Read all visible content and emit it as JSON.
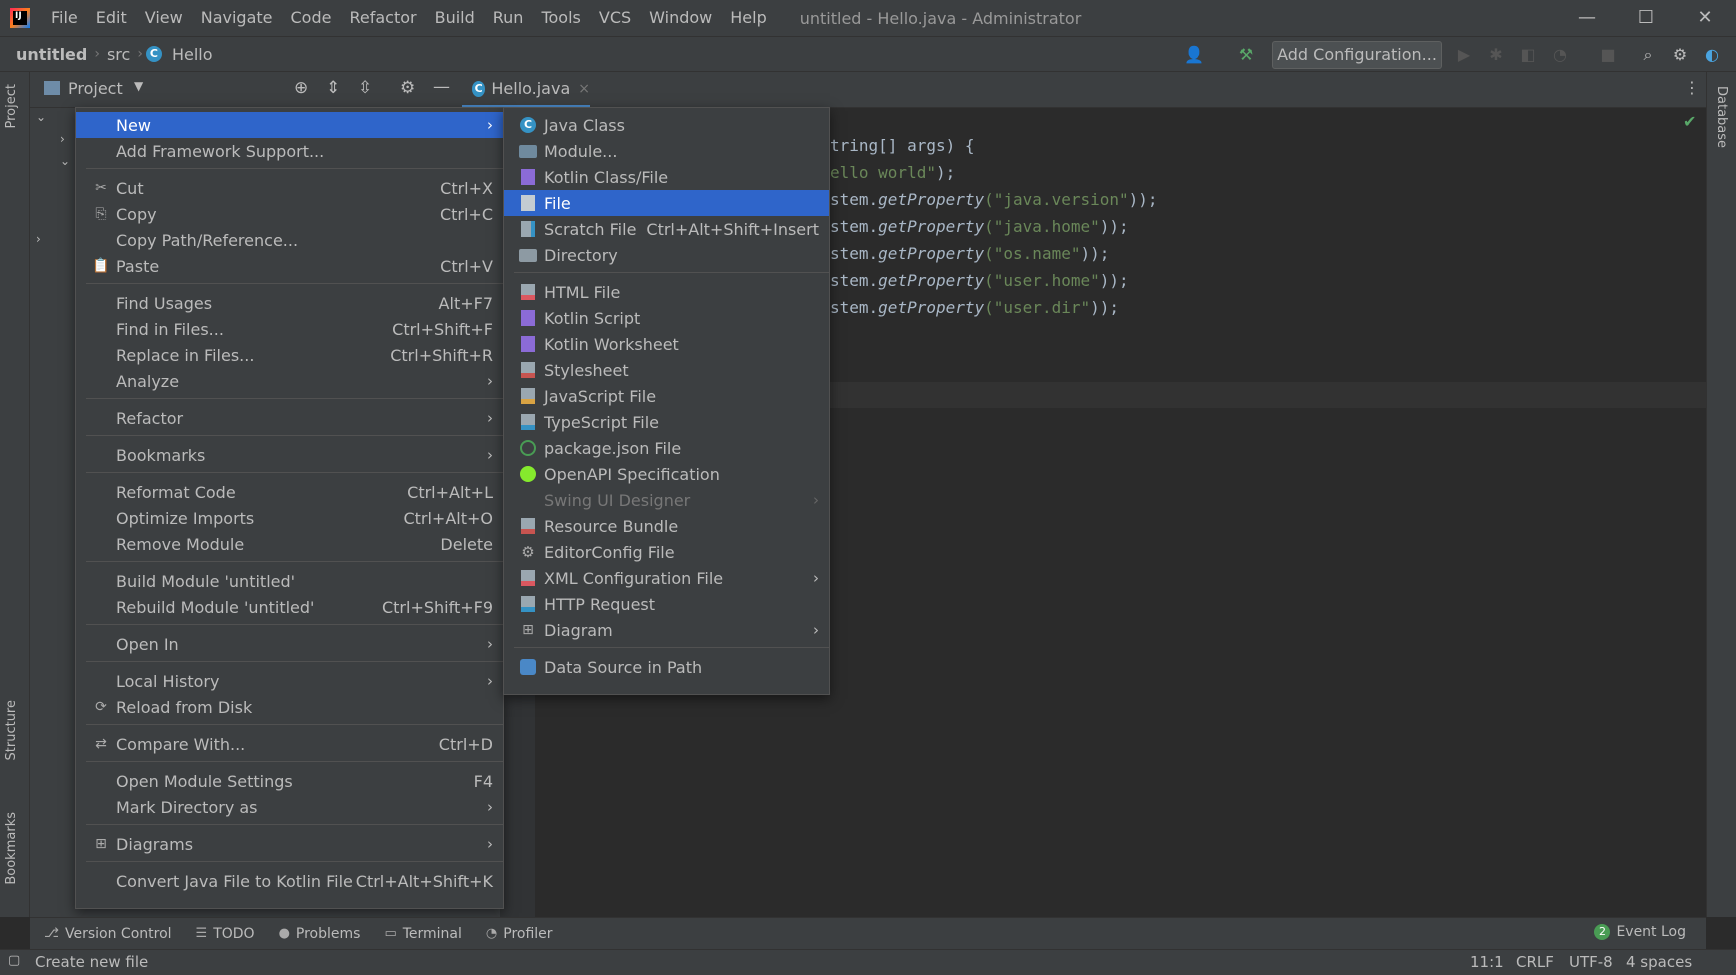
{
  "app": {
    "window_title": "untitled - Hello.java - Administrator",
    "menu": [
      "File",
      "Edit",
      "View",
      "Navigate",
      "Code",
      "Refactor",
      "Build",
      "Run",
      "Tools",
      "VCS",
      "Window",
      "Help"
    ],
    "win_controls": [
      "—",
      "☐",
      "✕"
    ]
  },
  "navbar": {
    "crumbs": [
      "untitled",
      "src",
      "Hello"
    ],
    "add_config_label": "Add Configuration..."
  },
  "project": {
    "header_label": "Project",
    "stripe_label": "Project",
    "structure_label": "Structure",
    "bookmarks_label": "Bookmarks",
    "database_label": "Database"
  },
  "editor": {
    "tab_label": "Hello.java",
    "tab_close": "×",
    "lines": [
      {
        "pre": "tring[] args) {",
        "fn": "",
        "str": "",
        "post": ""
      },
      {
        "pre": "",
        "fn": "",
        "str": "ello world\"",
        "post": ");"
      },
      {
        "pre": "stem.",
        "fn": "getProperty",
        "str": "(\"java.version\"",
        "post": "));"
      },
      {
        "pre": "stem.",
        "fn": "getProperty",
        "str": "(\"java.home\"",
        "post": "));"
      },
      {
        "pre": "stem.",
        "fn": "getProperty",
        "str": "(\"os.name\"",
        "post": "));"
      },
      {
        "pre": "stem.",
        "fn": "getProperty",
        "str": "(\"user.home\"",
        "post": "));"
      },
      {
        "pre": "stem.",
        "fn": "getProperty",
        "str": "(\"user.dir\"",
        "post": "));"
      }
    ]
  },
  "context_menu": [
    {
      "label": "New",
      "shortcut": "",
      "submenu": true,
      "icon": "",
      "selected": true
    },
    {
      "label": "Add Framework Support...",
      "shortcut": "",
      "submenu": false,
      "icon": ""
    },
    {
      "sep": true
    },
    {
      "label": "Cut",
      "shortcut": "Ctrl+X",
      "icon": "✂"
    },
    {
      "label": "Copy",
      "shortcut": "Ctrl+C",
      "icon": "⎘"
    },
    {
      "label": "Copy Path/Reference...",
      "shortcut": "",
      "icon": ""
    },
    {
      "label": "Paste",
      "shortcut": "Ctrl+V",
      "icon": "📋"
    },
    {
      "sep": true
    },
    {
      "label": "Find Usages",
      "shortcut": "Alt+F7",
      "icon": ""
    },
    {
      "label": "Find in Files...",
      "shortcut": "Ctrl+Shift+F",
      "icon": ""
    },
    {
      "label": "Replace in Files...",
      "shortcut": "Ctrl+Shift+R",
      "icon": ""
    },
    {
      "label": "Analyze",
      "shortcut": "",
      "submenu": true,
      "icon": ""
    },
    {
      "sep": true
    },
    {
      "label": "Refactor",
      "shortcut": "",
      "submenu": true,
      "icon": ""
    },
    {
      "sep": true
    },
    {
      "label": "Bookmarks",
      "shortcut": "",
      "submenu": true,
      "icon": ""
    },
    {
      "sep": true
    },
    {
      "label": "Reformat Code",
      "shortcut": "Ctrl+Alt+L",
      "icon": ""
    },
    {
      "label": "Optimize Imports",
      "shortcut": "Ctrl+Alt+O",
      "icon": ""
    },
    {
      "label": "Remove Module",
      "shortcut": "Delete",
      "icon": ""
    },
    {
      "sep": true
    },
    {
      "label": "Build Module 'untitled'",
      "shortcut": "",
      "icon": ""
    },
    {
      "label": "Rebuild Module 'untitled'",
      "shortcut": "Ctrl+Shift+F9",
      "icon": ""
    },
    {
      "sep": true
    },
    {
      "label": "Open In",
      "shortcut": "",
      "submenu": true,
      "icon": ""
    },
    {
      "sep": true
    },
    {
      "label": "Local History",
      "shortcut": "",
      "submenu": true,
      "icon": ""
    },
    {
      "label": "Reload from Disk",
      "shortcut": "",
      "icon": "⟳"
    },
    {
      "sep": true
    },
    {
      "label": "Compare With...",
      "shortcut": "Ctrl+D",
      "icon": "⇄"
    },
    {
      "sep": true
    },
    {
      "label": "Open Module Settings",
      "shortcut": "F4",
      "icon": ""
    },
    {
      "label": "Mark Directory as",
      "shortcut": "",
      "submenu": true,
      "icon": ""
    },
    {
      "sep": true
    },
    {
      "label": "Diagrams",
      "shortcut": "",
      "submenu": true,
      "icon": "⊞"
    },
    {
      "sep": true
    },
    {
      "label": "Convert Java File to Kotlin File",
      "shortcut": "Ctrl+Alt+Shift+K",
      "icon": ""
    }
  ],
  "sub_menu": [
    {
      "label": "Java Class",
      "icon": "java-class-icon",
      "glyph": "C"
    },
    {
      "label": "Module...",
      "icon": "module-icon",
      "glyph": ""
    },
    {
      "label": "Kotlin Class/File",
      "icon": "kotlin-file-icon",
      "glyph": ""
    },
    {
      "label": "File",
      "icon": "file-icon",
      "glyph": "",
      "selected": true
    },
    {
      "label": "Scratch File",
      "icon": "scratch-file-icon",
      "glyph": "",
      "shortcut": "Ctrl+Alt+Shift+Insert"
    },
    {
      "label": "Directory",
      "icon": "folder-icon",
      "glyph": ""
    },
    {
      "sep": true
    },
    {
      "label": "HTML File",
      "icon": "html-file-icon",
      "glyph": ""
    },
    {
      "label": "Kotlin Script",
      "icon": "kotlin-script-icon",
      "glyph": ""
    },
    {
      "label": "Kotlin Worksheet",
      "icon": "kotlin-worksheet-icon",
      "glyph": ""
    },
    {
      "label": "Stylesheet",
      "icon": "css-file-icon",
      "glyph": ""
    },
    {
      "label": "JavaScript File",
      "icon": "js-file-icon",
      "glyph": ""
    },
    {
      "label": "TypeScript File",
      "icon": "ts-file-icon",
      "glyph": ""
    },
    {
      "label": "package.json File",
      "icon": "package-json-icon",
      "glyph": ""
    },
    {
      "label": "OpenAPI Specification",
      "icon": "openapi-icon",
      "glyph": ""
    },
    {
      "label": "Swing UI Designer",
      "icon": "",
      "glyph": "",
      "disabled": true,
      "submenu": true
    },
    {
      "label": "Resource Bundle",
      "icon": "resource-bundle-icon",
      "glyph": ""
    },
    {
      "label": "EditorConfig File",
      "icon": "gear-icon",
      "glyph": ""
    },
    {
      "label": "XML Configuration File",
      "icon": "xml-file-icon",
      "glyph": "",
      "submenu": true
    },
    {
      "label": "HTTP Request",
      "icon": "http-request-icon",
      "glyph": ""
    },
    {
      "label": "Diagram",
      "icon": "diagram-icon",
      "glyph": "",
      "submenu": true
    },
    {
      "sep": true
    },
    {
      "label": "Data Source in Path",
      "icon": "database-icon",
      "glyph": ""
    }
  ],
  "bottom_tabs": [
    {
      "label": "Version Control",
      "icon": "⎇"
    },
    {
      "label": "TODO",
      "icon": "☰"
    },
    {
      "label": "Problems",
      "icon": "●"
    },
    {
      "label": "Terminal",
      "icon": "▭"
    },
    {
      "label": "Profiler",
      "icon": "◔"
    }
  ],
  "event_log": {
    "count": "2",
    "label": "Event Log"
  },
  "status": {
    "message": "Create new file",
    "position": "11:1",
    "line_sep": "CRLF",
    "encoding": "UTF-8",
    "indent": "4 spaces"
  },
  "colors": {
    "selection": "#2f65ca",
    "menu_bg": "#3c3f41",
    "editor_bg": "#2b2b2b"
  }
}
